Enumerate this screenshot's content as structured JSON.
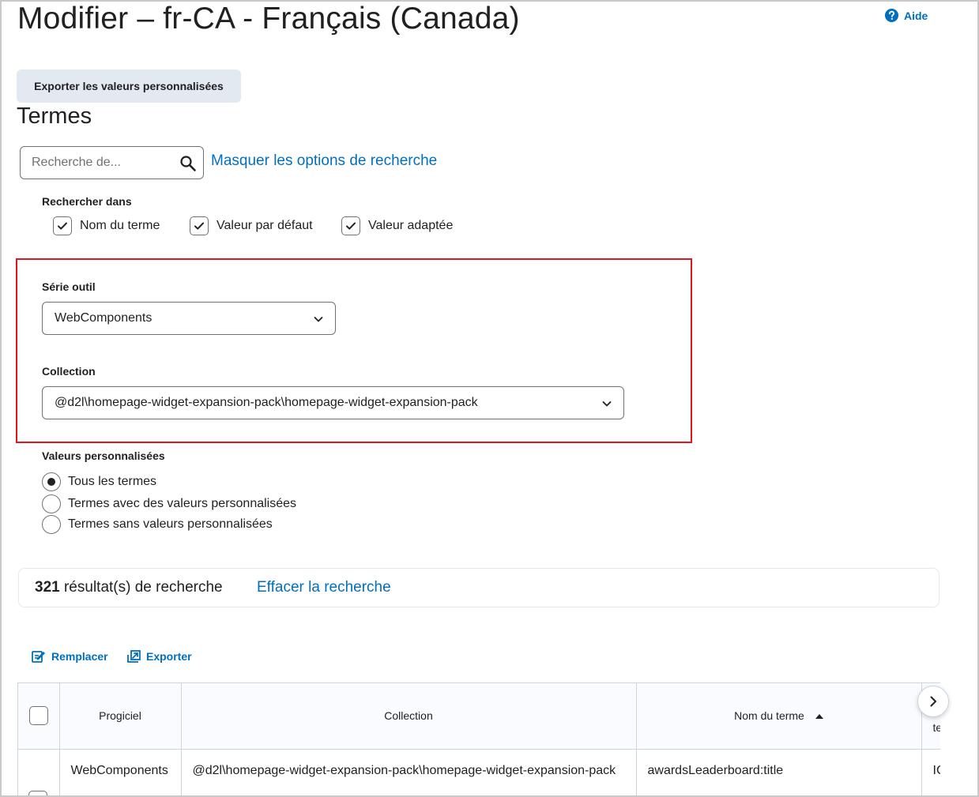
{
  "header": {
    "title": "Modifier – fr-CA - Français (Canada)",
    "help_label": "Aide"
  },
  "toolbar": {
    "export_custom_label": "Exporter les valeurs personnalisées"
  },
  "terms_section": {
    "title": "Termes"
  },
  "search": {
    "placeholder": "Recherche de...",
    "value": "",
    "toggle_options_label": "Masquer les options de recherche"
  },
  "search_in": {
    "label": "Rechercher dans",
    "options": [
      {
        "label": "Nom du terme",
        "checked": true
      },
      {
        "label": "Valeur par défaut",
        "checked": true
      },
      {
        "label": "Valeur adaptée",
        "checked": true
      }
    ]
  },
  "tool_series": {
    "label": "Série outil",
    "selected": "WebComponents"
  },
  "collection": {
    "label": "Collection",
    "selected": "@d2l\\homepage-widget-expansion-pack\\homepage-widget-expansion-pack"
  },
  "custom_values": {
    "label": "Valeurs personnalisées",
    "options": [
      {
        "label": "Tous les termes",
        "selected": true
      },
      {
        "label": "Termes avec des valeurs personnalisées",
        "selected": false
      },
      {
        "label": "Termes sans valeurs personnalisées",
        "selected": false
      }
    ]
  },
  "results": {
    "count": "321",
    "suffix": " résultat(s) de recherche",
    "clear_label": "Effacer la recherche"
  },
  "actions": {
    "replace_label": "Remplacer",
    "export_label": "Exporter"
  },
  "table": {
    "columns": [
      "Progiciel",
      "Collection",
      "Nom du terme",
      "te"
    ],
    "rows": [
      [
        "WebComponents",
        "@d2l\\homepage-widget-expansion-pack\\homepage-widget-expansion-pack",
        "awardsLeaderboard:title",
        "IC"
      ]
    ]
  },
  "colors": {
    "link": "#006fbf",
    "highlight_border": "#e0161f",
    "button_bg": "#e3e9f1"
  }
}
